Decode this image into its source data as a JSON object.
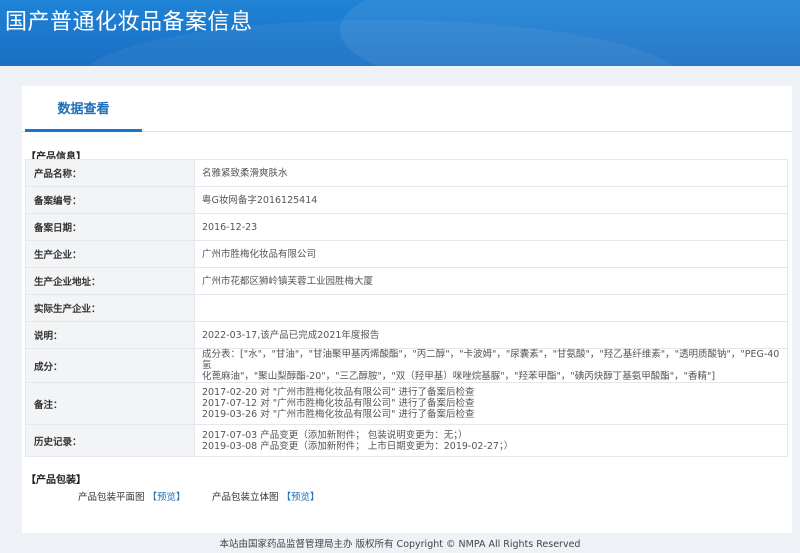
{
  "header": {
    "title": "国产普通化妆品备案信息"
  },
  "tabs": [
    {
      "label": "数据查看"
    }
  ],
  "product_info": {
    "section_title": "【产品信息】",
    "rows": [
      {
        "label": "产品名称：",
        "value": "名雅紧致柔滑爽肤水"
      },
      {
        "label": "备案编号：",
        "value": "粤G妆网备字2016125414"
      },
      {
        "label": "备案日期：",
        "value": "2016-12-23"
      },
      {
        "label": "生产企业：",
        "value": "广州市胜梅化妆品有限公司"
      },
      {
        "label": "生产企业地址：",
        "value": "广州市花都区狮岭镇芙蓉工业园胜梅大厦"
      },
      {
        "label": "实际生产企业：",
        "value": ""
      },
      {
        "label": "说明：",
        "value": "2022-03-17,该产品已完成2021年度报告"
      },
      {
        "label": "成分：",
        "lines": [
          "成分表：[\"水\"，\"甘油\"，\"甘油聚甲基丙烯酸酯\"，\"丙二醇\"，\"卡波姆\"，\"尿囊素\"，\"甘氨酸\"，\"羟乙基纤维素\"，\"透明质酸钠\"，\"PEG-40 氢",
          "化蓖麻油\"，\"聚山梨醇酯-20\"，\"三乙醇胺\"，\"双（羟甲基）咪唑烷基脲\"，\"羟苯甲酯\"，\"碘丙炔醇丁基氨甲酸酯\"，\"香精\"]"
        ]
      },
      {
        "label": "备注：",
        "lines": [
          "2017-02-20 对 \"广州市胜梅化妆品有限公司\" 进行了备案后检查",
          "2017-07-12 对 \"广州市胜梅化妆品有限公司\" 进行了备案后检查",
          "2019-03-26 对 \"广州市胜梅化妆品有限公司\" 进行了备案后检查"
        ]
      },
      {
        "label": "历史记录：",
        "lines": [
          "2017-07-03 产品变更（添加新附件； 包装说明变更为：无；）",
          "2019-03-08 产品变更（添加新附件； 上市日期变更为：2019-02-27；）"
        ]
      }
    ]
  },
  "packaging": {
    "section_title": "【产品包装】",
    "items": [
      {
        "label": "产品包装平面图",
        "link": "【预览】"
      },
      {
        "label": "产品包装立体图",
        "link": "【预览】"
      }
    ]
  },
  "footer": {
    "text": "本站由国家药品监督管理局主办 版权所有 Copyright © NMPA All Rights Reserved"
  }
}
